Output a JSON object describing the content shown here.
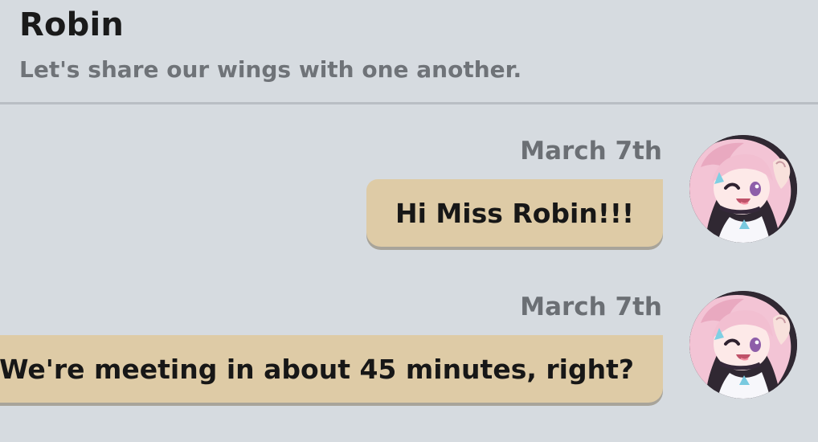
{
  "header": {
    "contact_name": "Robin",
    "contact_signature": "Let's share our wings with one another."
  },
  "messages": [
    {
      "sender": "March 7th",
      "text": "Hi Miss Robin!!!"
    },
    {
      "sender": "March 7th",
      "text": "We're meeting in about 45 minutes, right?"
    }
  ],
  "colors": {
    "background": "#d6dbe0",
    "bubble": "#decba6",
    "divider": "#b9bec4"
  },
  "icons": {
    "avatar": "march-7th-avatar-icon"
  }
}
